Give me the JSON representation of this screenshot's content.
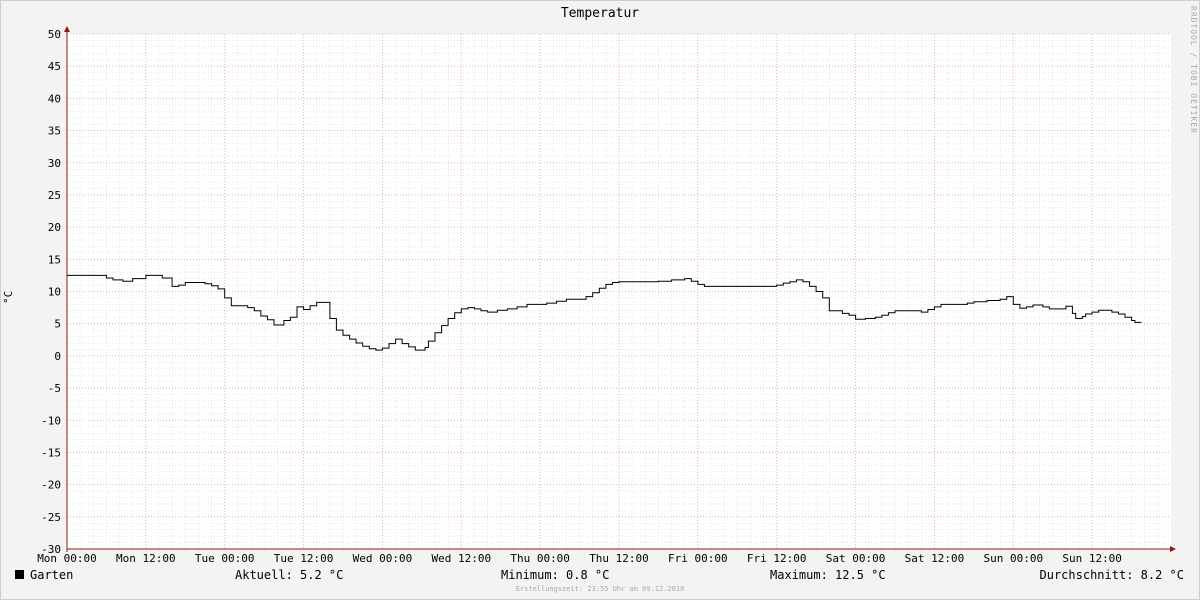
{
  "colors": {
    "background": "#f3f3f3",
    "canvas": "#ffffff",
    "grid_minor": "#d6d6d6",
    "grid_major": "#e5a0a0",
    "axis": "#8b1a1a",
    "line": "#000000"
  },
  "watermark": "RRDTOOL / TOBI OETIKER",
  "legend": {
    "series_name": "Garten",
    "aktuell": "Aktuell: 5.2 °C",
    "minimum": "Minimum: 0.8 °C",
    "maximum": "Maximum: 12.5 °C",
    "durchschnitt": "Durchschnitt: 8.2 °C"
  },
  "footer": "Erstellungszeit: 23:55 Uhr am 09.12.2018",
  "chart_data": {
    "type": "line",
    "title": "Temperatur",
    "ylabel": "°C",
    "xlabel": "",
    "ylim": [
      -30,
      50
    ],
    "y_ticks": [
      50,
      45,
      40,
      35,
      30,
      25,
      20,
      15,
      10,
      5,
      0,
      -5,
      -10,
      -15,
      -20,
      -25,
      -30
    ],
    "x_range_hours": [
      0,
      168
    ],
    "x_ticks": [
      {
        "hour": 0,
        "label": "Mon 00:00"
      },
      {
        "hour": 12,
        "label": "Mon 12:00"
      },
      {
        "hour": 24,
        "label": "Tue 00:00"
      },
      {
        "hour": 36,
        "label": "Tue 12:00"
      },
      {
        "hour": 48,
        "label": "Wed 00:00"
      },
      {
        "hour": 60,
        "label": "Wed 12:00"
      },
      {
        "hour": 72,
        "label": "Thu 00:00"
      },
      {
        "hour": 84,
        "label": "Thu 12:00"
      },
      {
        "hour": 96,
        "label": "Fri 00:00"
      },
      {
        "hour": 108,
        "label": "Fri 12:00"
      },
      {
        "hour": 120,
        "label": "Sat 00:00"
      },
      {
        "hour": 132,
        "label": "Sat 12:00"
      },
      {
        "hour": 144,
        "label": "Sun 00:00"
      },
      {
        "hour": 156,
        "label": "Sun 12:00"
      }
    ],
    "grid": true,
    "series": [
      {
        "name": "Garten",
        "style": "step",
        "points": [
          [
            0,
            12.5
          ],
          [
            6,
            12.1
          ],
          [
            7,
            11.8
          ],
          [
            8.5,
            11.6
          ],
          [
            10,
            12.0
          ],
          [
            12,
            12.5
          ],
          [
            14.5,
            12.1
          ],
          [
            16,
            10.8
          ],
          [
            17,
            11.0
          ],
          [
            18,
            11.4
          ],
          [
            21,
            11.2
          ],
          [
            22,
            10.9
          ],
          [
            23,
            10.4
          ],
          [
            24,
            9.0
          ],
          [
            25,
            7.8
          ],
          [
            27.5,
            7.5
          ],
          [
            28.5,
            7.0
          ],
          [
            29.5,
            6.2
          ],
          [
            30.5,
            5.6
          ],
          [
            31.5,
            4.8
          ],
          [
            33,
            5.5
          ],
          [
            34,
            6.0
          ],
          [
            35,
            7.6
          ],
          [
            36,
            7.2
          ],
          [
            37,
            7.8
          ],
          [
            38,
            8.3
          ],
          [
            40,
            5.8
          ],
          [
            41,
            4.0
          ],
          [
            42,
            3.2
          ],
          [
            43,
            2.6
          ],
          [
            44,
            2.0
          ],
          [
            45,
            1.5
          ],
          [
            46,
            1.1
          ],
          [
            47,
            0.9
          ],
          [
            48,
            1.2
          ],
          [
            49,
            1.9
          ],
          [
            50,
            2.6
          ],
          [
            51,
            1.9
          ],
          [
            52,
            1.4
          ],
          [
            53,
            0.9
          ],
          [
            54.5,
            1.3
          ],
          [
            55,
            2.3
          ],
          [
            56,
            3.6
          ],
          [
            57,
            4.7
          ],
          [
            58,
            5.8
          ],
          [
            59,
            6.7
          ],
          [
            60,
            7.3
          ],
          [
            61,
            7.5
          ],
          [
            62,
            7.3
          ],
          [
            63,
            7.0
          ],
          [
            64,
            6.8
          ],
          [
            65.5,
            7.1
          ],
          [
            67,
            7.3
          ],
          [
            68.5,
            7.6
          ],
          [
            70,
            8.0
          ],
          [
            73,
            8.2
          ],
          [
            74.5,
            8.5
          ],
          [
            76,
            8.8
          ],
          [
            79,
            9.2
          ],
          [
            80,
            9.8
          ],
          [
            81,
            10.5
          ],
          [
            82,
            11.1
          ],
          [
            83,
            11.4
          ],
          [
            84,
            11.5
          ],
          [
            90,
            11.6
          ],
          [
            92,
            11.8
          ],
          [
            94,
            12.0
          ],
          [
            95,
            11.6
          ],
          [
            96,
            11.1
          ],
          [
            97,
            10.8
          ],
          [
            102,
            10.8
          ],
          [
            106,
            10.8
          ],
          [
            108,
            11.0
          ],
          [
            109,
            11.3
          ],
          [
            110,
            11.5
          ],
          [
            111,
            11.8
          ],
          [
            112,
            11.5
          ],
          [
            113,
            10.8
          ],
          [
            114,
            10.0
          ],
          [
            115,
            9.0
          ],
          [
            116,
            7.0
          ],
          [
            118,
            6.6
          ],
          [
            119,
            6.3
          ],
          [
            120,
            5.7
          ],
          [
            121.5,
            5.8
          ],
          [
            123,
            6.0
          ],
          [
            124,
            6.3
          ],
          [
            125,
            6.7
          ],
          [
            126,
            7.0
          ],
          [
            130,
            6.8
          ],
          [
            131,
            7.2
          ],
          [
            132,
            7.6
          ],
          [
            133,
            8.0
          ],
          [
            137,
            8.2
          ],
          [
            138,
            8.4
          ],
          [
            140,
            8.6
          ],
          [
            142,
            8.8
          ],
          [
            143,
            9.2
          ],
          [
            144,
            8.0
          ],
          [
            145,
            7.4
          ],
          [
            146,
            7.6
          ],
          [
            147,
            7.9
          ],
          [
            148.5,
            7.6
          ],
          [
            149.5,
            7.3
          ],
          [
            152,
            7.7
          ],
          [
            153,
            6.6
          ],
          [
            153.5,
            5.8
          ],
          [
            154.5,
            6.1
          ],
          [
            155,
            6.5
          ],
          [
            156,
            6.8
          ],
          [
            157,
            7.1
          ],
          [
            159,
            6.8
          ],
          [
            160,
            6.5
          ],
          [
            161,
            6.0
          ],
          [
            162,
            5.5
          ],
          [
            162.5,
            5.2
          ],
          [
            163.5,
            5.2
          ]
        ]
      }
    ]
  }
}
